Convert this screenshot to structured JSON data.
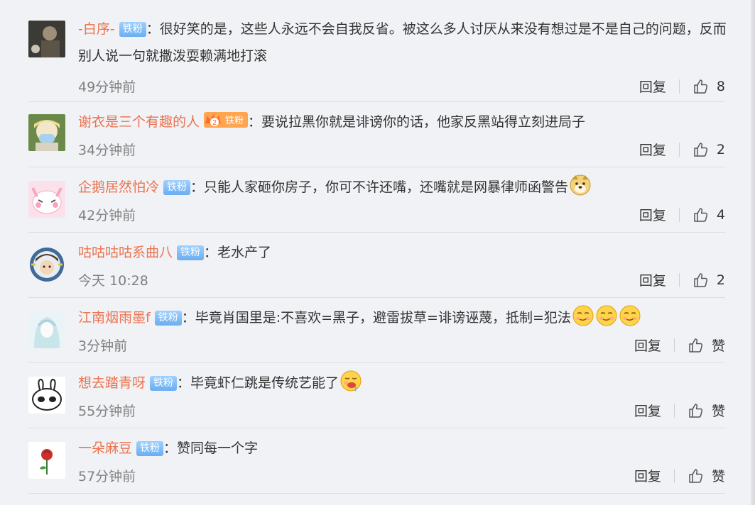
{
  "comments": [
    {
      "user": "-白序-",
      "badge": "铁粉",
      "text": "：很好笑的是，这些人永远不会自我反省。被这么多人讨厌从来没有想过是不是自己的问题，反而别人说一句就撒泼耍赖满地打滚",
      "time": "49分钟前",
      "reply": "回复",
      "like": "8",
      "avatar": "dark-portrait-avatar"
    },
    {
      "user": "谢衣是三个有趣的人",
      "badge": "铁粉",
      "crown_level": "2",
      "text": "：要说拉黑你就是诽谤你的话，他家反黑站得立刻进局子",
      "time": "34分钟前",
      "reply": "回复",
      "like": "2",
      "avatar": "masked-girl-avatar"
    },
    {
      "user": "企鹅居然怕冷",
      "badge": "铁粉",
      "text": "：只能人家砸你房子，你可不许还嘴，还嘴就是网暴律师函警告",
      "emoji": [
        "doge-emoji"
      ],
      "time": "42分钟前",
      "reply": "回复",
      "like": "4",
      "avatar": "pink-rabbit-avatar"
    },
    {
      "user": "咕咕咕咕系曲八",
      "badge": "铁粉",
      "text": "：老水产了",
      "time": "今天 10:28",
      "reply": "回复",
      "like": "2",
      "avatar": "cartoon-boy-avatar"
    },
    {
      "user": "江南烟雨墨f",
      "badge": "铁粉",
      "text": "：毕竟肖国里是:不喜欢=黑子，避雷拔草=诽谤诬蔑，抵制=犯法",
      "emoji": [
        "smirk-emoji",
        "smirk-emoji",
        "smirk-emoji"
      ],
      "time": "3分钟前",
      "reply": "回复",
      "like": "赞",
      "avatar": "ghost-girl-avatar"
    },
    {
      "user": "想去踏青呀",
      "badge": "铁粉",
      "text": "：毕竟虾仁跳是传统艺能了",
      "emoji": [
        "drool-emoji"
      ],
      "time": "55分钟前",
      "reply": "回复",
      "like": "赞",
      "avatar": "bunny-sketch-avatar"
    },
    {
      "user": "一朵麻豆",
      "badge": "铁粉",
      "text": "：赞同每一个字",
      "time": "57分钟前",
      "reply": "回复",
      "like": "赞",
      "avatar": "rose-avatar"
    }
  ],
  "colors": {
    "username": "#eb7350",
    "badge": "#6aaef0",
    "meta": "#808080"
  }
}
